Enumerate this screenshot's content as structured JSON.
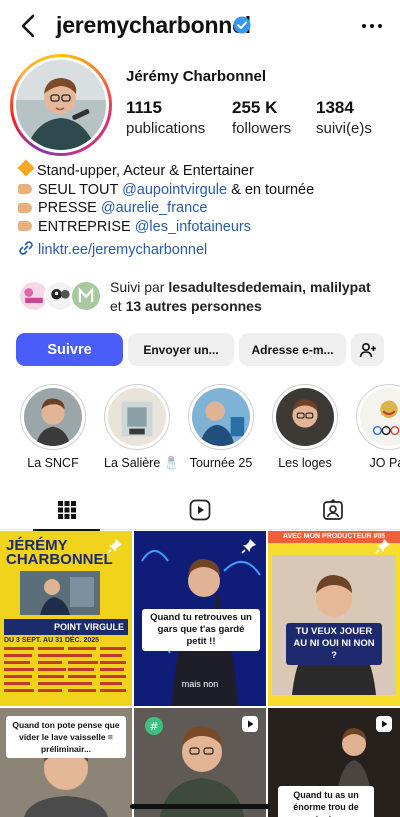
{
  "header": {
    "username": "jeremycharbonnel",
    "verified": true,
    "icons": [
      "back-arrow-icon",
      "verified-badge-icon",
      "more-dots-icon"
    ]
  },
  "profile": {
    "full_name": "Jérémy Charbonnel",
    "stats": {
      "posts": {
        "value": "1115",
        "label": "publications"
      },
      "followers": {
        "value": "255 K",
        "label": "followers"
      },
      "following": {
        "value": "1384",
        "label": "suivi(e)s"
      }
    },
    "bio": {
      "line1": "Stand-upper, Acteur & Entertainer",
      "line2_prefix": "SEUL TOUT ",
      "line2_mention": "@aupointvirgule",
      "line2_suffix": " & en tournée",
      "line3_prefix": "PRESSE ",
      "line3_mention": "@aurelie_france",
      "line4_prefix": "ENTREPRISE ",
      "line4_mention": "@les_infotaineurs"
    },
    "link": "linktr.ee/jeremycharbonnel",
    "followed_by": {
      "prefix": "Suivi par ",
      "names": "lesadultesdedemain, malilypat",
      "middle": "et ",
      "others": "13 autres personnes"
    }
  },
  "actions": {
    "follow": "Suivre",
    "message": "Envoyer un...",
    "email": "Adresse e-m..."
  },
  "highlights": [
    {
      "label": "La SNCF"
    },
    {
      "label": "La Salière 🧂"
    },
    {
      "label": "Tournée 25"
    },
    {
      "label": "Les loges"
    },
    {
      "label": "JO Par"
    }
  ],
  "tabs": [
    "grid-icon",
    "reels-icon",
    "tagged-icon"
  ],
  "grid": {
    "post1": {
      "title": "JÉRÉMY CHARBONNEL",
      "venue": "POINT VIRGULE",
      "dates": "DU 3 SEPT. AU 31 DÉC. 2025"
    },
    "post2": {
      "caption": "Quand tu retrouves un gars que t'as gardé petit !!",
      "subtitle": "mais non"
    },
    "post3": {
      "top_text": "AVEC MON PRODUCTEUR #05",
      "caption": "TU VEUX JOUER AU NI OUI NI NON ?"
    },
    "post4": {
      "caption": "Quand ton pote pense que vider le lave vaisselle = préliminair..."
    },
    "post5": {},
    "post6": {
      "caption": "Quand tu as un énorme trou de texte"
    }
  },
  "colors": {
    "follow_button": "#4a5df9",
    "link": "#2b5aa8",
    "verified": "#3897f0"
  }
}
